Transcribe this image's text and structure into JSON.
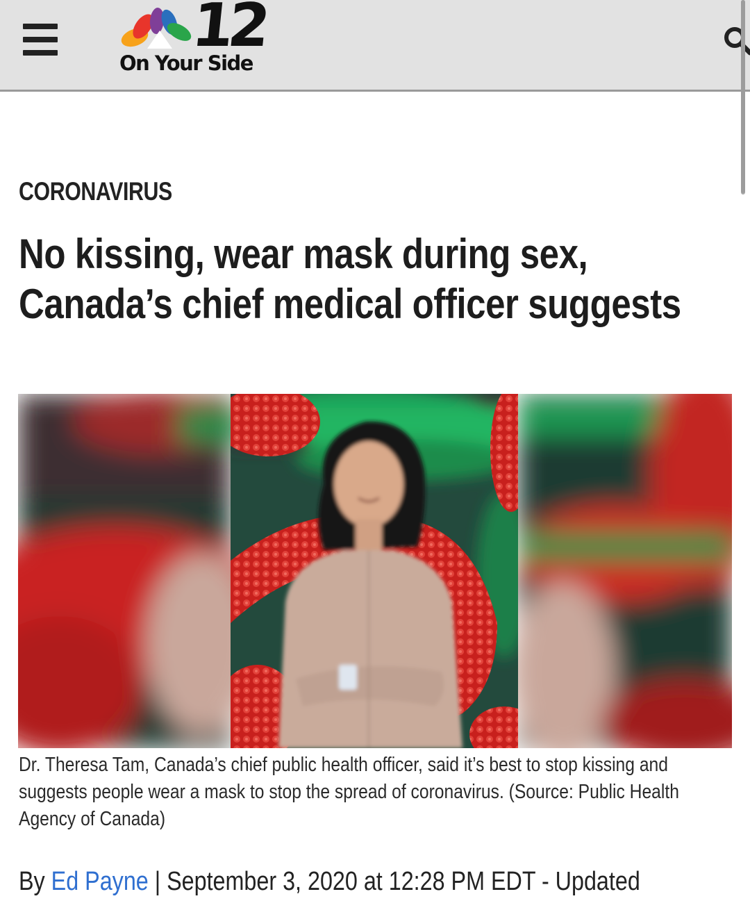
{
  "header": {
    "station_number": "12",
    "tagline": "On Your Side",
    "menu_icon": "hamburger-menu-icon",
    "search_icon": "search-icon"
  },
  "article": {
    "category": "CORONAVIRUS",
    "headline": "No kissing, wear mask during sex, Canada’s chief medical officer suggests",
    "caption": "Dr. Theresa Tam, Canada’s chief public health officer, said it’s best to stop kissing and suggests people wear a mask to stop the spread of coronavirus. (Source: Public Health Agency of Canada)",
    "byline": {
      "prefix": "By",
      "author": "Ed Payne",
      "separator": "|",
      "date": "September 3, 2020 at 12:28 PM EDT - Updated"
    }
  },
  "colors": {
    "header_bg": "#e2e2e2",
    "author_link": "#2f6fd0",
    "text": "#1d1d1d"
  }
}
